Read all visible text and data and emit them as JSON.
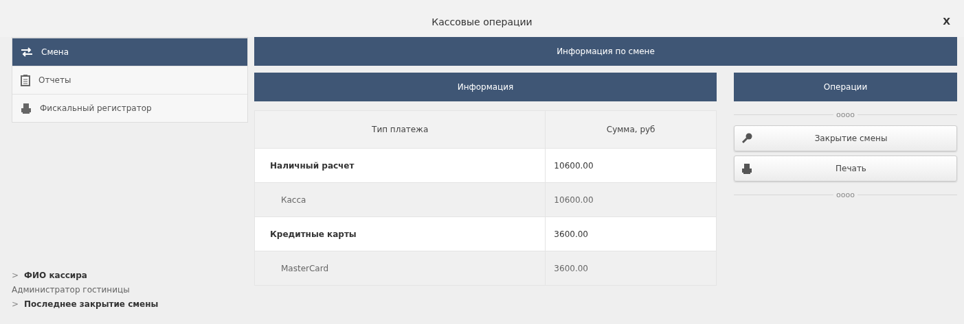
{
  "window": {
    "title": "Кассовые операции",
    "close": "X"
  },
  "sidebar": {
    "items": [
      {
        "label": "Смена",
        "kind": "swap",
        "selected": true
      },
      {
        "label": "Отчеты",
        "kind": "clipboard",
        "selected": false
      },
      {
        "label": "Фискальный регистратор",
        "kind": "printer",
        "selected": false
      }
    ],
    "footer": [
      {
        "kind": "heading",
        "text": "ФИО кассира",
        "marker": ">"
      },
      {
        "kind": "value",
        "text": "Администратор гостиницы"
      },
      {
        "kind": "heading",
        "text": "Последнее закрытие смены",
        "marker": ">"
      }
    ]
  },
  "main": {
    "header": "Информация по смене",
    "info": {
      "header": "Информация",
      "columns": [
        "Тип платежа",
        "Сумма, руб"
      ],
      "rows": [
        {
          "kind": "group",
          "cells": [
            "Наличный расчет",
            "10600.00"
          ]
        },
        {
          "kind": "item",
          "cells": [
            "Касса",
            "10600.00"
          ]
        },
        {
          "kind": "group",
          "cells": [
            "Кредитные карты",
            "3600.00"
          ]
        },
        {
          "kind": "item",
          "cells": [
            "MasterCard",
            "3600.00"
          ]
        }
      ]
    },
    "operations": {
      "header": "Операции",
      "separators": [
        "oooo",
        "oooo"
      ],
      "buttons": [
        {
          "label": "Закрытие смены",
          "kind": "key"
        },
        {
          "label": "Печать",
          "kind": "printer"
        }
      ]
    }
  }
}
